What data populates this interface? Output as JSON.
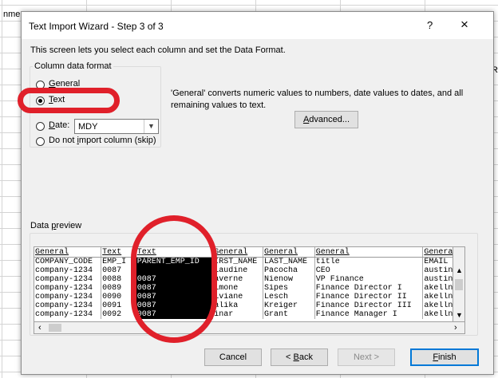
{
  "sheet": {
    "left_fragment": "nme",
    "right_fragment": "R"
  },
  "dialog": {
    "title": "Text Import Wizard - Step 3 of 3",
    "help_label": "?",
    "close_label": "×",
    "description": "This screen lets you select each column and set the Data Format.",
    "column_format": {
      "group_label": "Column data format",
      "options": [
        {
          "hotkey": "G",
          "rest": "eneral",
          "selected": false
        },
        {
          "hotkey": "T",
          "rest": "ext",
          "selected": true
        },
        {
          "hotkey": "D",
          "rest": "ate:",
          "selected": false
        },
        {
          "prefix": "Do not ",
          "hotkey": "i",
          "rest": "mport column (skip)",
          "selected": false
        }
      ],
      "date_format": "MDY"
    },
    "info_text": "'General' converts numeric values to numbers, date values to dates, and all remaining values to text.",
    "advanced_button": {
      "hotkey": "A",
      "rest": "dvanced..."
    },
    "preview": {
      "label_prefix": "Data ",
      "label_hotkey": "p",
      "label_rest": "review",
      "headers": [
        "General",
        "Text",
        "Text",
        "General",
        "General",
        "General",
        "Genera"
      ],
      "rows": [
        [
          "COMPANY_CODE",
          "EMP_I",
          "PARENT_EMP_ID",
          "IRST_NAME",
          "LAST_NAME",
          "title",
          "EMAIL"
        ],
        [
          "company-1234",
          "0087",
          "",
          "laudine",
          "Pacocha",
          "CEO",
          "austin"
        ],
        [
          "company-1234",
          "0088",
          "0087",
          "averne",
          "Nienow",
          "VP Finance",
          "austin"
        ],
        [
          "company-1234",
          "0089",
          "0087",
          "imone",
          "Sipes",
          "Finance Director I",
          "akelln"
        ],
        [
          "company-1234",
          "0090",
          "0087",
          "iviane",
          "Lesch",
          "Finance Director II",
          "akelln"
        ],
        [
          "company-1234",
          "0091",
          "0087",
          "alika",
          "Kreiger",
          "Finance Director III",
          "akelln"
        ],
        [
          "company-1234",
          "0092",
          "0087",
          "inar",
          "Grant",
          "Finance Manager I",
          "akelln"
        ]
      ],
      "selected_column": 2
    },
    "buttons": {
      "cancel": "Cancel",
      "back_prefix": "< ",
      "back_hotkey": "B",
      "back_rest": "ack",
      "next": "Next >",
      "finish_hotkey": "F",
      "finish_rest": "inish"
    }
  },
  "colors": {
    "annotation": "#e0202a",
    "selection": "#000000"
  }
}
